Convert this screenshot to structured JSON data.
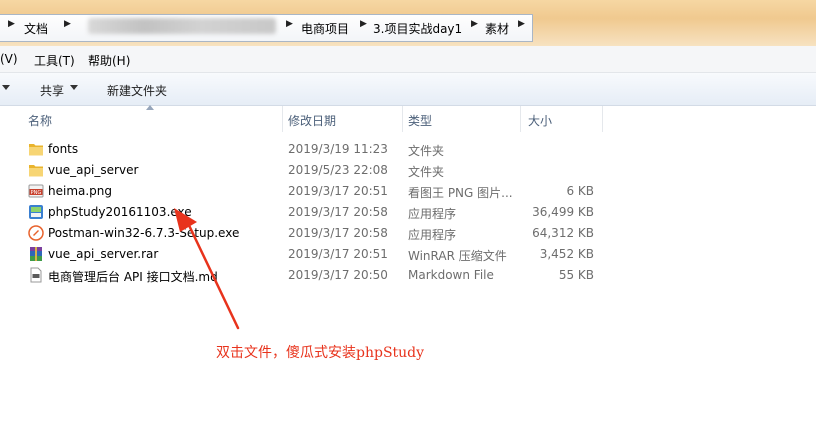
{
  "address": {
    "crumbs": [
      "文档",
      "电商项目",
      "3.项目实战day1",
      "素材"
    ]
  },
  "menu": {
    "items": [
      "(V)",
      "工具(T)",
      "帮助(H)"
    ]
  },
  "toolbar": {
    "share": "共享",
    "new_folder": "新建文件夹"
  },
  "columns": {
    "name": "名称",
    "date": "修改日期",
    "type": "类型",
    "size": "大小"
  },
  "files": [
    {
      "name": "fonts",
      "date": "2019/3/19 11:23",
      "type": "文件夹",
      "size": "",
      "icon": "folder-icon"
    },
    {
      "name": "vue_api_server",
      "date": "2019/5/23 22:08",
      "type": "文件夹",
      "size": "",
      "icon": "folder-icon"
    },
    {
      "name": "heima.png",
      "date": "2019/3/17 20:51",
      "type": "看图王 PNG 图片...",
      "size": "6 KB",
      "icon": "png-image-icon"
    },
    {
      "name": "phpStudy20161103.exe",
      "date": "2019/3/17 20:58",
      "type": "应用程序",
      "size": "36,499 KB",
      "icon": "phpstudy-app-icon"
    },
    {
      "name": "Postman-win32-6.7.3-Setup.exe",
      "date": "2019/3/17 20:58",
      "type": "应用程序",
      "size": "64,312 KB",
      "icon": "postman-app-icon"
    },
    {
      "name": "vue_api_server.rar",
      "date": "2019/3/17 20:51",
      "type": "WinRAR 压缩文件",
      "size": "3,452 KB",
      "icon": "winrar-archive-icon"
    },
    {
      "name": "电商管理后台 API 接口文档.md",
      "date": "2019/3/17 20:50",
      "type": "Markdown File",
      "size": "55 KB",
      "icon": "markdown-file-icon"
    }
  ],
  "annotation": {
    "text": "双击文件，傻瓜式安装phpStudy",
    "color": "#e8331c"
  }
}
